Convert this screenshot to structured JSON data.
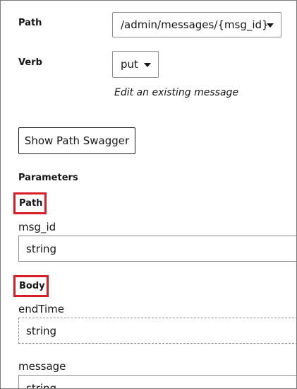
{
  "form": {
    "path": {
      "label": "Path",
      "selected": "/admin/messages/{msg_id}"
    },
    "verb": {
      "label": "Verb",
      "selected": "put",
      "description": "Edit an existing message"
    },
    "show_swagger_label": "Show Path Swagger",
    "parameters_heading": "Parameters",
    "path_section": {
      "heading": "Path",
      "fields": [
        {
          "label": "msg_id",
          "value": "string"
        }
      ]
    },
    "body_section": {
      "heading": "Body",
      "fields": [
        {
          "label": "endTime",
          "value": "string"
        },
        {
          "label": "message",
          "value": "string"
        }
      ]
    }
  },
  "colors": {
    "highlight": "#da1e28",
    "border": "#8d8d8d",
    "text": "#161616"
  }
}
